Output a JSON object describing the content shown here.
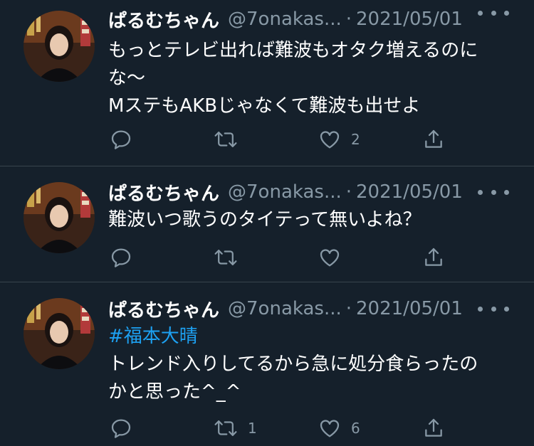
{
  "colors": {
    "background": "#15202b",
    "text": "#ffffff",
    "muted": "#8899a6",
    "hashtag": "#1da1f2",
    "divider": "#38444d"
  },
  "tweets": [
    {
      "name": "ぱるむちゃん",
      "handle": "@7onakas...",
      "separator": "·",
      "date": "2021/05/01",
      "lines": [
        "もっとテレビ出れば難波もオタク増えるのに",
        "な〜",
        "MステもAKBじゃなくて難波も出せよ"
      ],
      "reply_count": "",
      "retweet_count": "",
      "like_count": "2"
    },
    {
      "name": "ぱるむちゃん",
      "handle": "@7onakas...",
      "separator": "·",
      "date": "2021/05/01",
      "lines": [
        "難波いつ歌うのタイテって無いよね？"
      ],
      "reply_count": "",
      "retweet_count": "",
      "like_count": ""
    },
    {
      "name": "ぱるむちゃん",
      "handle": "@7onakas...",
      "separator": "·",
      "date": "2021/05/01",
      "hashtag": "#福本大晴",
      "lines": [
        "トレンド入りしてるから急に処分食らったの",
        "かと思った^_^"
      ],
      "reply_count": "",
      "retweet_count": "1",
      "like_count": "6"
    }
  ],
  "icons": [
    "avatar",
    "more-icon",
    "reply-icon",
    "retweet-icon",
    "like-icon",
    "share-icon"
  ]
}
